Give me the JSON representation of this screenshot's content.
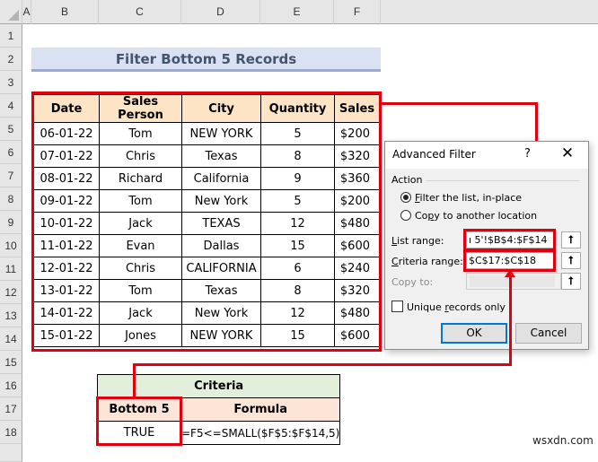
{
  "sheet": {
    "column_headers": [
      "A",
      "B",
      "C",
      "D",
      "E",
      "F"
    ],
    "row_headers": [
      "1",
      "2",
      "3",
      "4",
      "5",
      "6",
      "7",
      "8",
      "9",
      "10",
      "11",
      "12",
      "13",
      "14",
      "15",
      "16",
      "17",
      "18"
    ],
    "title": "Filter Bottom 5 Records",
    "table": {
      "headers": [
        "Date",
        "Sales Person",
        "City",
        "Quantity",
        "Sales"
      ],
      "rows": [
        [
          "06-01-22",
          "Tom",
          "NEW YORK",
          "5",
          "$200"
        ],
        [
          "07-01-22",
          "Chris",
          "Texas",
          "8",
          "$320"
        ],
        [
          "08-01-22",
          "Richard",
          "California",
          "9",
          "$360"
        ],
        [
          "09-01-22",
          "Tom",
          "New York",
          "5",
          "$200"
        ],
        [
          "10-01-22",
          "Jack",
          "TEXAS",
          "12",
          "$480"
        ],
        [
          "11-01-22",
          "Evan",
          "Dallas",
          "15",
          "$600"
        ],
        [
          "12-01-22",
          "Chris",
          "CALIFORNIA",
          "6",
          "$240"
        ],
        [
          "13-01-22",
          "Tom",
          "Texas",
          "8",
          "$320"
        ],
        [
          "14-01-22",
          "Jack",
          "New York",
          "12",
          "$480"
        ],
        [
          "15-01-22",
          "Jones",
          "NEW YORK",
          "15",
          "$600"
        ]
      ]
    },
    "criteria": {
      "title": "Criteria",
      "headers": [
        "Bottom 5",
        "Formula"
      ],
      "values": [
        "TRUE",
        "=F5<=SMALL($F$5:$F$14,5)"
      ]
    }
  },
  "dialog": {
    "title": "Advanced Filter",
    "help": "?",
    "close": "✕",
    "action_label": "Action",
    "radio_filter_first": "F",
    "radio_filter_rest": "ilter the list, in-place",
    "radio_copy_first": "Co",
    "radio_copy_ul": "p",
    "radio_copy_rest": "y to another location",
    "selected_action": "filter",
    "list_range_ul": "L",
    "list_range_rest": "ist range:",
    "list_range_value": "ı 5'!$B$4:$F$14",
    "criteria_range_ul": "C",
    "criteria_range_rest": "riteria range:",
    "criteria_range_value": "$C$17:$C$18",
    "copy_to_label": "Copy to:",
    "copy_to_value": "",
    "unique_pre": "Unique ",
    "unique_ul": "r",
    "unique_rest": "ecords only",
    "unique_checked": false,
    "ref_icon": "⭡",
    "ok_label": "OK",
    "cancel_label": "Cancel"
  },
  "colors": {
    "highlight": "#e0000e",
    "title_bg": "#dae1f3",
    "header_bg": "#fce4c4",
    "criteria_title_bg": "#e2efda",
    "criteria_header_bg": "#fce4d6"
  },
  "watermark": "wsxdn.com"
}
